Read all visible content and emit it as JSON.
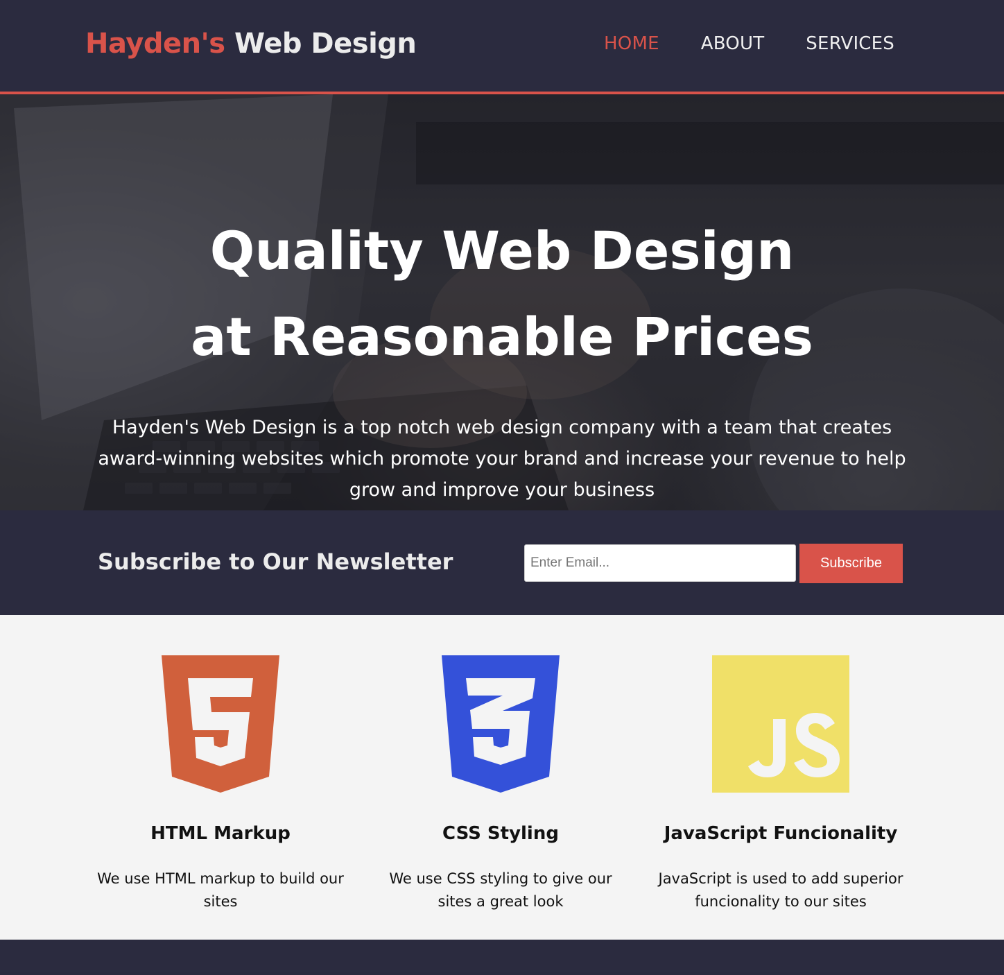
{
  "header": {
    "brand_highlight": "Hayden's",
    "brand_rest": "Web Design",
    "nav": [
      {
        "label": "HOME",
        "active": true
      },
      {
        "label": "ABOUT",
        "active": false
      },
      {
        "label": "SERVICES",
        "active": false
      }
    ]
  },
  "hero": {
    "title": "Quality Web Design at Reasonable Prices",
    "description": "Hayden's Web Design is a top notch web design company with a team that creates award-winning websites which promote your brand and increase your revenue to help grow and improve your business"
  },
  "newsletter": {
    "heading": "Subscribe to Our Newsletter",
    "email_placeholder": "Enter Email...",
    "email_value": "",
    "subscribe_label": "Subscribe"
  },
  "features": [
    {
      "icon": "html5-logo-icon",
      "title": "HTML Markup",
      "description": "We use HTML markup to build our sites"
    },
    {
      "icon": "css3-logo-icon",
      "title": "CSS Styling",
      "description": "We use CSS styling to give our sites a great look"
    },
    {
      "icon": "javascript-logo-icon",
      "title": "JavaScript Funcionality",
      "description": "JavaScript is used to add superior funcionality to our sites"
    }
  ],
  "colors": {
    "accent": "#d9534a",
    "dark_bg": "#2b2b3f",
    "light_bg": "#f4f4f4",
    "html5": "#d0603c",
    "css3": "#3451d9",
    "javascript": "#f0e068"
  }
}
